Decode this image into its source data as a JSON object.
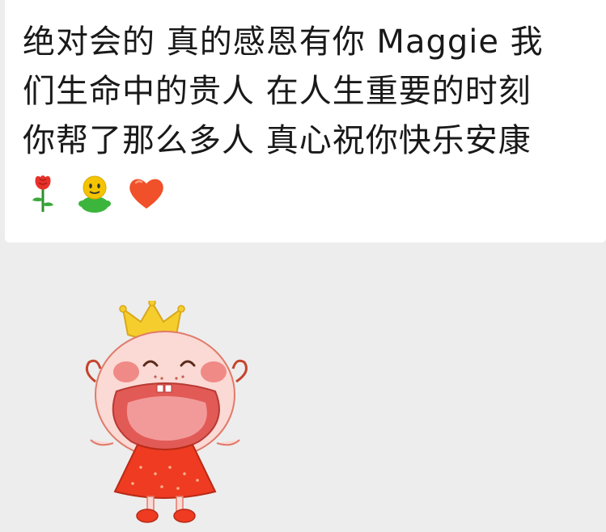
{
  "message": {
    "lines": [
      "绝对会的 真的感恩有你 Maggie 我",
      "们生命中的贵人 在人生重要的时刻",
      "你帮了那么多人 真心祝你快乐安康"
    ],
    "emojis": [
      "rose-icon",
      "smiley-icon",
      "heart-icon"
    ]
  },
  "sticker": {
    "name": "princess-cheering-sticker"
  },
  "colors": {
    "background": "#ededed",
    "bubble": "#ffffff",
    "text": "#191919",
    "heart": "#f0502a",
    "rose": "#e8312a",
    "smiley_face": "#f5c400",
    "smiley_body": "#3cb53c",
    "crown": "#f5cd2d",
    "dress": "#ee3b22",
    "skin": "#fbd9d5"
  }
}
